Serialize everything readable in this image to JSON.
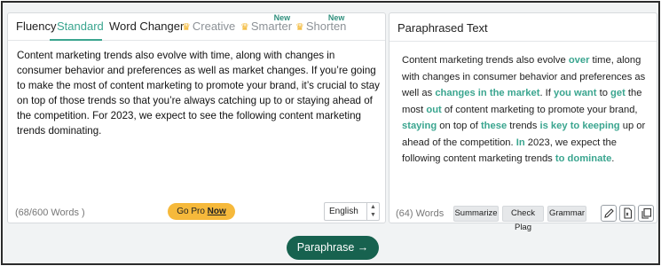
{
  "tabs": [
    {
      "label": "Fluency"
    },
    {
      "label": "Standard"
    },
    {
      "label": "Word Changer"
    },
    {
      "label": "Creative"
    },
    {
      "label": "Smarter",
      "badge": "New"
    },
    {
      "label": "Shorten",
      "badge": "New"
    }
  ],
  "input": {
    "text": "Content marketing trends also evolve with time, along with changes in consumer behavior and preferences as well as market changes. If you’re going to make the most of content marketing to promote your brand, it’s crucial to stay on top of those trends so that you’re always catching up to or staying ahead of the competition. For 2023, we expect to see the following content marketing trends dominating.",
    "word_count": "(68/600 Words )",
    "gopro_prefix": "Go Pro",
    "gopro_link": "Now",
    "language": "English"
  },
  "output": {
    "title": "Paraphrased Text",
    "segments": [
      {
        "t": "Content marketing trends also evolve ",
        "h": false
      },
      {
        "t": "over",
        "h": true
      },
      {
        "t": " time, along with changes in consumer behavior and preferences as well as ",
        "h": false
      },
      {
        "t": "changes in the market",
        "h": true
      },
      {
        "t": ". If ",
        "h": false
      },
      {
        "t": "you want",
        "h": true
      },
      {
        "t": " to ",
        "h": false
      },
      {
        "t": "get",
        "h": true
      },
      {
        "t": " the most ",
        "h": false
      },
      {
        "t": "out",
        "h": true
      },
      {
        "t": " of content marketing to promote your brand, ",
        "h": false
      },
      {
        "t": "staying",
        "h": true
      },
      {
        "t": " on top of ",
        "h": false
      },
      {
        "t": "these",
        "h": true
      },
      {
        "t": " trends ",
        "h": false
      },
      {
        "t": "is key to keeping",
        "h": true
      },
      {
        "t": " up or ahead of the competition. ",
        "h": false
      },
      {
        "t": "In",
        "h": true
      },
      {
        "t": " 2023, we expect the following content marketing trends ",
        "h": false
      },
      {
        "t": "to dominate",
        "h": true
      },
      {
        "t": ".",
        "h": false
      }
    ],
    "word_count": "(64) Words",
    "buttons": {
      "summarize": "Summarize",
      "check_plag": "Check Plag",
      "grammar": "Grammar"
    }
  },
  "action": {
    "paraphrase": "Paraphrase →"
  },
  "colors": {
    "accent": "#3aa58f",
    "primary_button": "#17624f",
    "gopro": "#f6b93b",
    "crown": "#f2b01e"
  },
  "icons": [
    "crown-icon",
    "pencil-icon",
    "document-icon",
    "copy-icon",
    "chevron-updown-icon"
  ]
}
